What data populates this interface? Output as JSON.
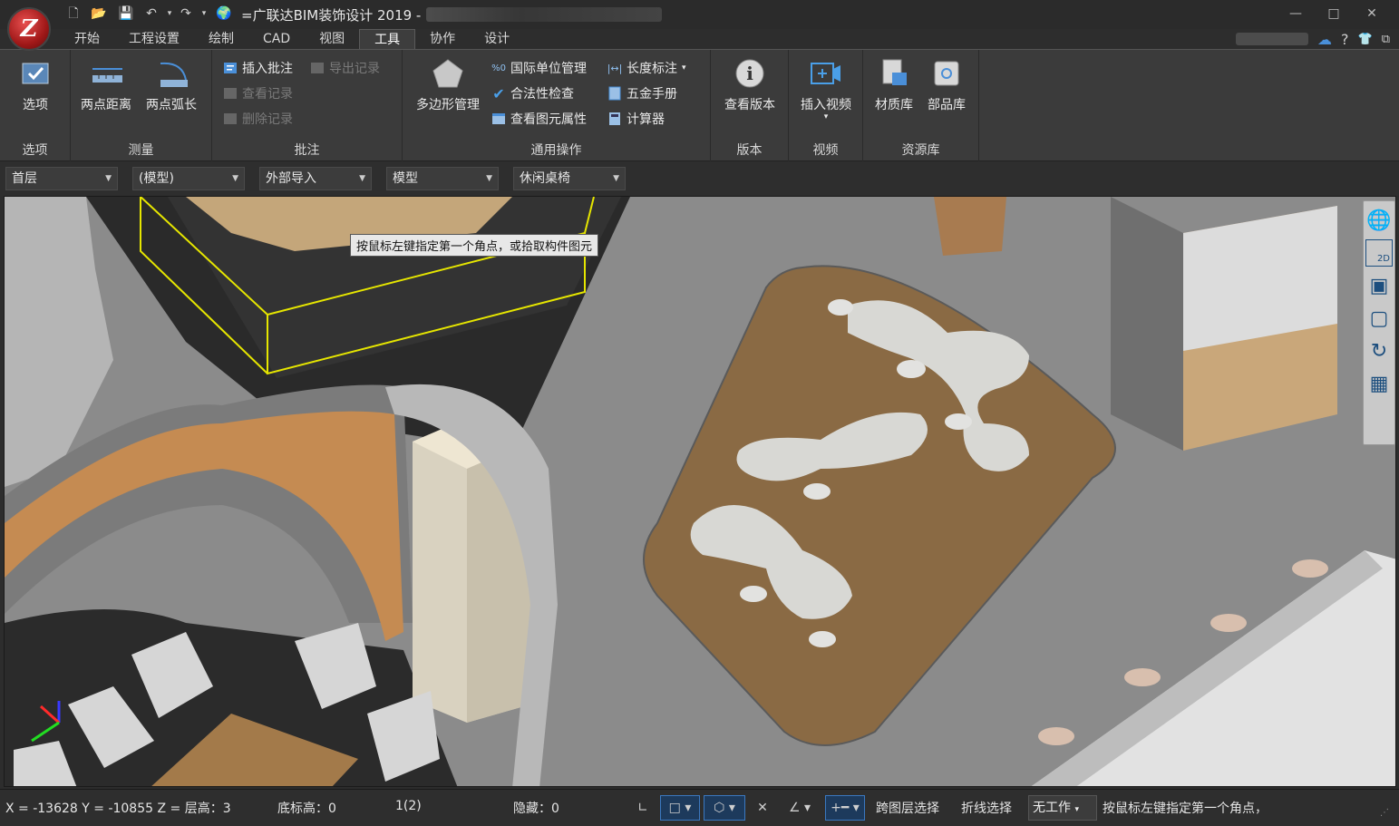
{
  "app": {
    "title": "=广联达BIM装饰设计 2019 -",
    "logo_letter": "Z"
  },
  "quick_access": [
    "new-file-icon",
    "open-folder-icon",
    "save-icon",
    "undo-icon",
    "redo-icon",
    "sync-icon"
  ],
  "tabs": [
    "开始",
    "工程设置",
    "绘制",
    "CAD",
    "视图",
    "工具",
    "协作",
    "设计"
  ],
  "active_tab": "工具",
  "help_label": "?",
  "ribbon": {
    "groups": {
      "options": {
        "label": "选项",
        "button": "选项"
      },
      "measure": {
        "label": "测量",
        "buttons": [
          "两点距离",
          "两点弧长"
        ]
      },
      "annotate": {
        "label": "批注",
        "items": [
          {
            "text": "插入批注",
            "enabled": true
          },
          {
            "text": "导出记录",
            "enabled": false
          },
          {
            "text": "查看记录",
            "enabled": false
          },
          {
            "text": "删除记录",
            "enabled": false
          }
        ]
      },
      "general": {
        "label": "通用操作",
        "big": "多边形管理",
        "items": [
          "国际单位管理",
          "合法性检查",
          "查看图元属性",
          "长度标注",
          "五金手册",
          "计算器"
        ]
      },
      "version": {
        "label": "版本",
        "button": "查看版本"
      },
      "video": {
        "label": "视频",
        "button": "插入视频"
      },
      "resources": {
        "label": "资源库",
        "buttons": [
          "材质库",
          "部品库"
        ]
      }
    }
  },
  "dropdowns": [
    "首层",
    "(模型)",
    "外部导入",
    "模型",
    "休闲桌椅"
  ],
  "viewport": {
    "tooltip": "按鼠标左键指定第一个角点，或拾取构件图元",
    "viewcube_labels": [
      "2D"
    ]
  },
  "status": {
    "coords": "X = -13628 Y = -10855 Z = 层高：3",
    "base_elev": "底标高：0",
    "count": "1(2)",
    "hidden": "隐藏：0",
    "cross_layer": "跨图层选择",
    "polyline_select": "折线选择",
    "workspace": "无工作",
    "prompt": "按鼠标左键指定第一个角点，"
  }
}
